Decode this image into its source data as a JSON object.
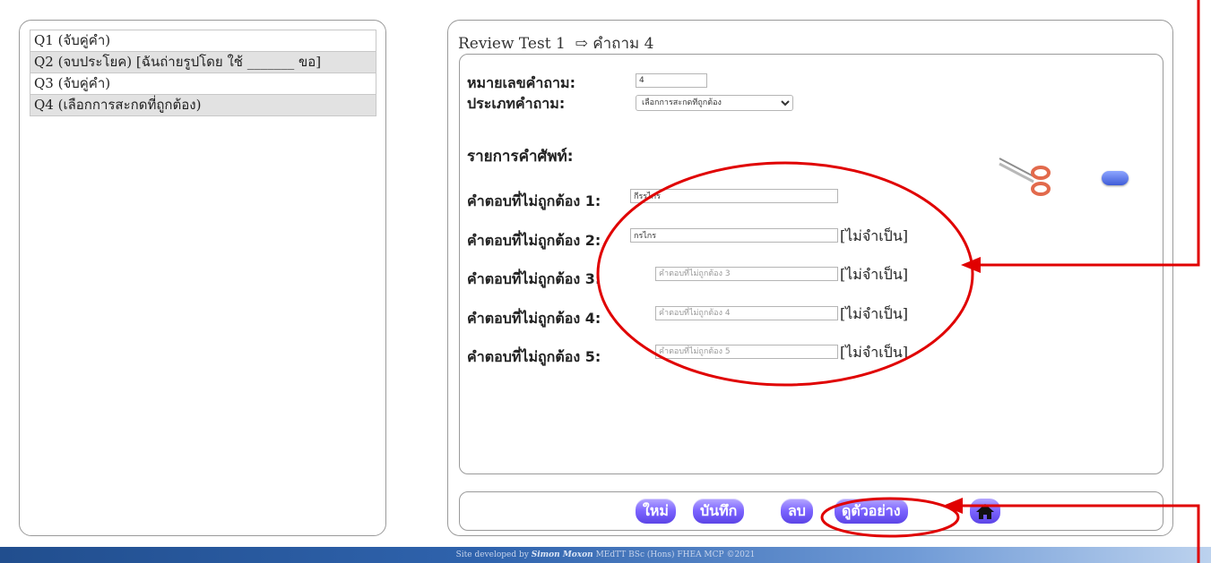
{
  "questions": [
    {
      "label": "Q1 (จับคู่คำ)"
    },
    {
      "label": "Q2 (จบประโยค) [ฉันถ่ายรูปโดย ใช้ _______ ขอ]"
    },
    {
      "label": "Q3 (จับคู่คำ)"
    },
    {
      "label": "Q4 (เลือกการสะกดที่ถูกต้อง)"
    }
  ],
  "header": {
    "test_name": "Review Test 1",
    "arrow": "⇨",
    "current": "คำถาม 4"
  },
  "form": {
    "qnum_label": "หมายเลขคำถาม:",
    "qnum_value": "4",
    "qtype_label": "ประเภทคำถาม:",
    "qtype_value": "เลือกการสะกดที่ถูกต้อง",
    "vocab_label": "รายการคำศัพท์:",
    "wrong_answers": [
      {
        "label": "คำตอบที่ไม่ถูกต้อง 1:",
        "value": "กีรรไกร",
        "placeholder": "",
        "optional": ""
      },
      {
        "label": "คำตอบที่ไม่ถูกต้อง 2:",
        "value": "กรไกร",
        "placeholder": "",
        "optional": "[ไม่จำเป็น]"
      },
      {
        "label": "คำตอบที่ไม่ถูกต้อง 3:",
        "value": "",
        "placeholder": "คำตอบที่ไม่ถูกต้อง 3",
        "optional": "[ไม่จำเป็น]"
      },
      {
        "label": "คำตอบที่ไม่ถูกต้อง 4:",
        "value": "",
        "placeholder": "คำตอบที่ไม่ถูกต้อง 4",
        "optional": "[ไม่จำเป็น]"
      },
      {
        "label": "คำตอบที่ไม่ถูกต้อง 5:",
        "value": "",
        "placeholder": "คำตอบที่ไม่ถูกต้อง 5",
        "optional": "[ไม่จำเป็น]"
      }
    ]
  },
  "icons": {
    "vocab_image": "scissors-icon",
    "vocab_action": "pill-button-icon",
    "home": "home-icon"
  },
  "buttons": {
    "new": "ใหม่",
    "save": "บันทึก",
    "delete": "ลบ",
    "preview": "ดูตัวอย่าง"
  },
  "footer": {
    "prefix": "Site developed by",
    "author": "Simon Moxon",
    "credentials": "MEdTT  BSc (Hons)  FHEA  MCP  ©2021"
  },
  "colors": {
    "button": "#7b63ff",
    "annotation": "#e00000",
    "footer": "#2f63ad"
  }
}
